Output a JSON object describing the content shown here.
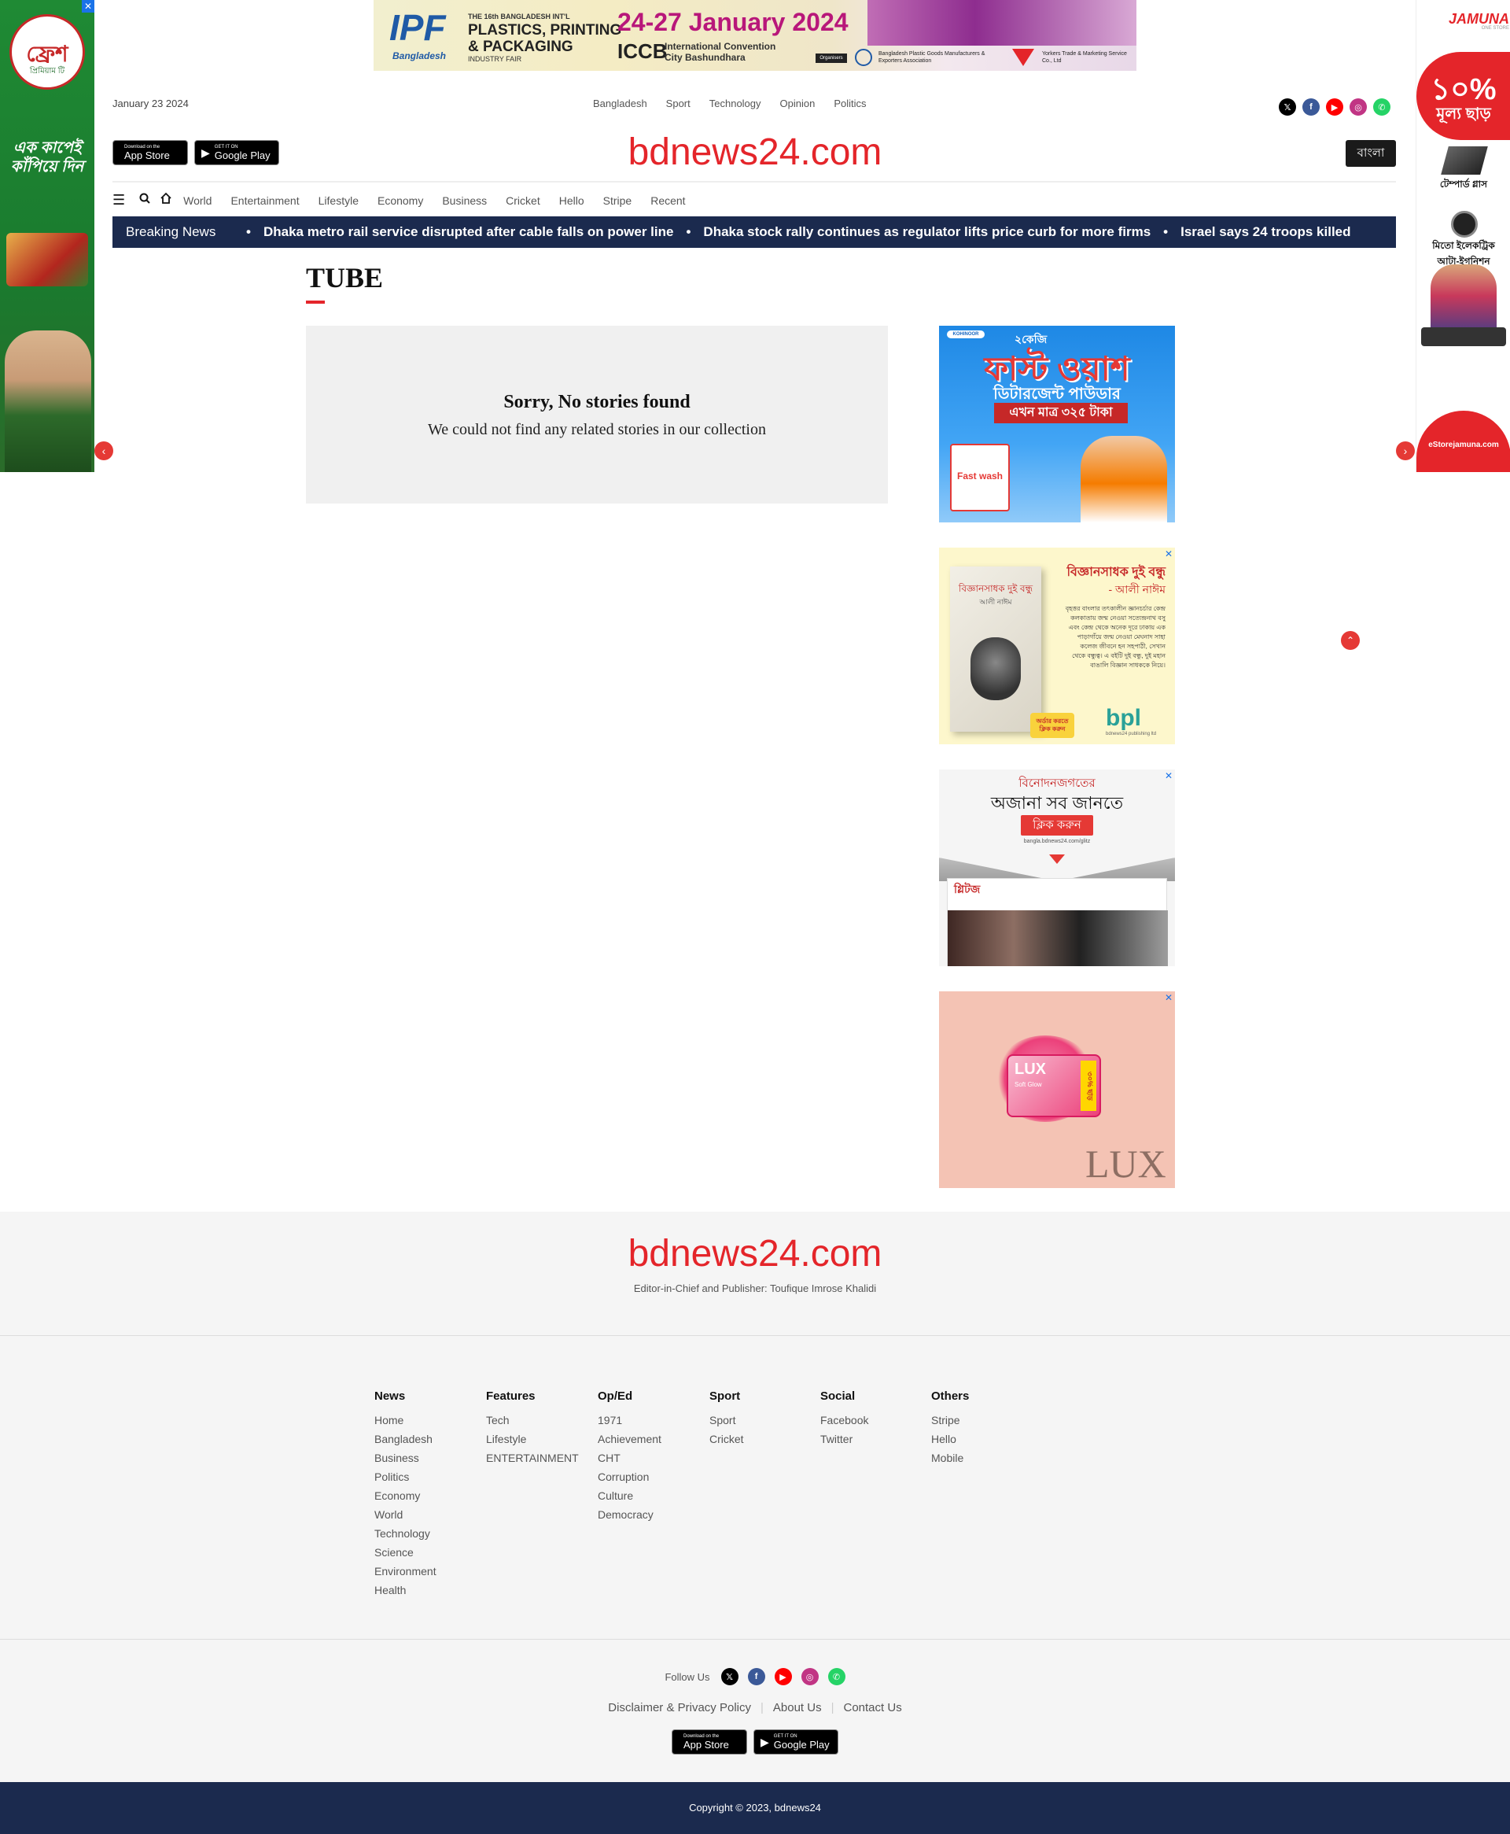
{
  "ads": {
    "top_banner": {
      "line1": "THE 16th BANGLADESH INT'L",
      "line2": "PLASTICS, PRINTING",
      "line3": "& PACKAGING",
      "line4": "INDUSTRY FAIR",
      "brand": "Bangladesh",
      "dates": "24-27 January 2024",
      "venue_short": "ICCB",
      "venue_line1": "International Convention",
      "venue_line2": "City Bashundhara",
      "organisers": "Organisers",
      "org1": "Bangladesh Plastic Goods Manufacturers & Exporters Association",
      "org2": "Yorkers Trade & Marketing Service Co., Ltd"
    },
    "skin_left": {
      "brand": "ফ্রেশ",
      "sub": "প্রিমিয়াম টি",
      "tagline": "এক কাপেই কাঁপিয়ে দিন"
    },
    "skin_right": {
      "brand": "JAMUNA",
      "sub": "ONE STORE",
      "discount": "১০%",
      "discount_sub": "মূল্য ছাড়",
      "item1": "টেম্পার্ড গ্লাস",
      "item2": "মিতো ইলেকট্রিক আটা-ইগনিশন",
      "site": "eStorejamuna.com"
    },
    "side1": {
      "brand": "KOHINOOR",
      "title": "ফাস্ট ওয়াশ",
      "sub": "ডিটারজেন্ট পাউডার",
      "price": "এখন মাত্র ৩২৫ টাকা",
      "qty": "২কেজি",
      "pack": "Fast wash"
    },
    "side2": {
      "title": "বিজ্ঞানসাধক দুই বন্ধু",
      "author": "- আলী নাঈম",
      "body": "বৃহত্তর বাংলার তৎকালীন জ্ঞানচর্চার কেন্দ্র কলকাতায় জন্ম নেওয়া সত্যেন্দ্রনাথ বসু এবং কেন্দ্র থেকে অনেক দূরে ঢাকায় এক পাড়াগাঁয়ে জন্ম নেওয়া মেঘনাদ সাহা কলেজ জীবনে হন সহপাঠী, সেখান থেকে বন্ধুত্ব। এ বইটি দুই বন্ধু, দুই মহান বাঙালি বিজ্ঞান সাধককে নিয়ে।",
      "cta": "অর্ডার করতে ক্লিক করুন",
      "publisher": "bpl",
      "publisher_sub": "bdnews24 publishing ltd",
      "book_title": "বিজ্ঞানসাধক দুই বন্ধু",
      "book_author": "আলী নাঈম"
    },
    "side3": {
      "line1": "বিনোদনজগতের",
      "line2": "অজানা সব জানতে",
      "cta": "ক্লিক করুন",
      "url": "bangla.bdnews24.com/glitz",
      "site": "গ্লিটজ"
    },
    "side4": {
      "brand": "LUX",
      "pack": "LUX",
      "pack_sub": "Soft Glow",
      "badge": "৩০% ছাড়"
    }
  },
  "header": {
    "date": "January 23 2024",
    "topnav": [
      "Bangladesh",
      "Sport",
      "Technology",
      "Opinion",
      "Politics"
    ],
    "app_store": {
      "small": "Download on the",
      "big": "App Store"
    },
    "google_play": {
      "small": "GET IT ON",
      "big": "Google Play"
    },
    "logo": "bdnews24.com",
    "lang_button": "বাংলা",
    "mainnav": [
      "World",
      "Entertainment",
      "Lifestyle",
      "Economy",
      "Business",
      "Cricket",
      "Hello",
      "Stripe",
      "Recent"
    ]
  },
  "ticker": {
    "label": "Breaking News",
    "items": [
      "Dhaka metro rail service disrupted after cable falls on power line",
      "Dhaka stock rally continues as regulator lifts price curb for more firms",
      "Israel says 24 troops killed"
    ]
  },
  "main": {
    "title": "TUBE",
    "empty_heading": "Sorry, No stories found",
    "empty_text": "We could not find any related stories in our collection"
  },
  "footer": {
    "logo": "bdnews24.com",
    "editor": "Editor-in-Chief and Publisher: Toufique Imrose Khalidi",
    "columns": [
      {
        "heading": "News",
        "links": [
          "Home",
          "Bangladesh",
          "Business",
          "Politics",
          "Economy",
          "World",
          "Technology",
          "Science",
          "Environment",
          "Health"
        ]
      },
      {
        "heading": "Features",
        "links": [
          "Tech",
          "Lifestyle",
          "ENTERTAINMENT"
        ]
      },
      {
        "heading": "Op/Ed",
        "links": [
          "1971",
          "Achievement",
          "CHT",
          "Corruption",
          "Culture",
          "Democracy"
        ]
      },
      {
        "heading": "Sport",
        "links": [
          "Sport",
          "Cricket"
        ]
      },
      {
        "heading": "Social",
        "links": [
          "Facebook",
          "Twitter"
        ]
      },
      {
        "heading": "Others",
        "links": [
          "Stripe",
          "Hello",
          "Mobile"
        ]
      }
    ],
    "follow_label": "Follow Us",
    "legal": [
      "Disclaimer & Privacy Policy",
      "About Us",
      "Contact Us"
    ],
    "copyright": "Copyright © 2023, bdnews24"
  },
  "colors": {
    "brand_red": "#e4252a",
    "navy": "#1b2a4e",
    "x": "#000000",
    "facebook": "#3b5998",
    "youtube": "#ff0000",
    "instagram": "#c13584",
    "whatsapp": "#25d366"
  },
  "icons": {
    "social": [
      "x-icon",
      "facebook-icon",
      "youtube-icon",
      "instagram-icon",
      "whatsapp-icon"
    ],
    "nav": [
      "hamburger-icon",
      "search-icon",
      "home-icon"
    ]
  }
}
